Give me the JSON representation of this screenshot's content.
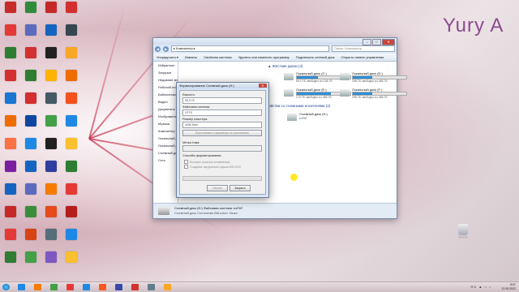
{
  "watermark": "Yury A",
  "desktop": {
    "icon_colors": [
      [
        "#c92a2a",
        "#2f8b3b",
        "#c62828",
        "#d32f2f"
      ],
      [
        "#e53935",
        "#5c6bc0",
        "#1565c0",
        "#37474f"
      ],
      [
        "#2e7d32",
        "#d32f2f",
        "#212121",
        "#f9a825"
      ],
      [
        "#d32f2f",
        "#2e7d32",
        "#ffb300",
        "#ef6c00"
      ],
      [
        "#1976d2",
        "#d32f2f",
        "#455a64",
        "#f4511e"
      ],
      [
        "#ef6c00",
        "#0d47a1",
        "#43a047",
        "#1e88e5"
      ],
      [
        "#ff7043",
        "#1e88e5",
        "#212121",
        "#fbc02d"
      ],
      [
        "#7b1fa2",
        "#1565c0",
        "#303f9f",
        "#2e7d32"
      ],
      [
        "#1565c0",
        "#5c6bc0",
        "#f57c00",
        "#e53935"
      ],
      [
        "#c62828",
        "#388e3c",
        "#e64a19",
        "#b71c1c"
      ],
      [
        "#e53935",
        "#d84315",
        "#546e7a",
        "#1e88e5"
      ],
      [
        "#2e7d32",
        "#43a047",
        "#7e57c2",
        "#fbc02d"
      ]
    ],
    "recycle_label": "Корзина"
  },
  "explorer": {
    "address": "▸ Компьютер ▸",
    "search_placeholder": "Поиск: Компьютер",
    "toolbar": [
      "Упорядочить ▾",
      "Извлечь",
      "Свойства системы",
      "Удалить или изменить программу",
      "Подключить сетевой диск",
      "Открыть панель управления"
    ],
    "nav": [
      "Избранное",
      "Загрузки",
      "Недавние места",
      "Рабочий стол",
      "Библиотеки",
      "Видео",
      "Документы",
      "Изображения",
      "Музыка",
      "Компьютер",
      "Локальный диск",
      "Локальный диск",
      "Съемный диск",
      "Сеть"
    ],
    "group_hdd": "▲ Жесткие диски (4)",
    "group_removable": "▲ Устройства со съемными носителями (2)",
    "drives": [
      {
        "name": "Локальный диск (C:)",
        "free": "89,0 ГБ свободно из 146 ГБ",
        "fill": 0.39
      },
      {
        "name": "Локальный диск (D:)",
        "free": "298 ГБ свободно из 465 ГБ",
        "fill": 0.36
      },
      {
        "name": "Локальный диск (E:)",
        "free": "174 ГБ свободно из 465 ГБ",
        "fill": 0.63
      },
      {
        "name": "Локальный диск (F:)",
        "free": "298 ГБ свободно из 465 ГБ",
        "fill": 0.36
      }
    ],
    "removable": {
      "name": "Съемный диск (H:)",
      "fs": "exFAT"
    },
    "status_line1": "Съемный диск (H:)   Файловая система: exFAT",
    "status_line2": "Съемный диск   Состояние BitLocker: Выкл"
  },
  "dialog": {
    "title": "Форматирование Съемный диск (H:)",
    "close": "✕",
    "capacity_label": "Емкость:",
    "capacity_value": "58,5 ГБ",
    "fs_label": "Файловая система:",
    "fs_value": "NTFS",
    "cluster_label": "Размер кластера:",
    "cluster_value": "4096 байт",
    "restore_defaults": "Восстановить параметры по умолчанию",
    "volume_label": "Метка тома:",
    "volume_value": "",
    "methods_label": "Способы форматирования:",
    "quick": "Быстрое (очистка оглавления)",
    "msdos": "Создание загрузочного диска MS-DOS",
    "start": "Начать",
    "close_btn": "Закрыть"
  },
  "taskbar": {
    "buttons": [
      "#1e88e5",
      "#f57c00",
      "#43a047",
      "#e53935",
      "#1e88e5",
      "#ff5722",
      "#3949ab",
      "#d32f2f",
      "#607d8b",
      "#f9a825"
    ],
    "tray": "RU ▲ ⌂ ♪",
    "time": "8:57",
    "date": "12.05.2022"
  }
}
